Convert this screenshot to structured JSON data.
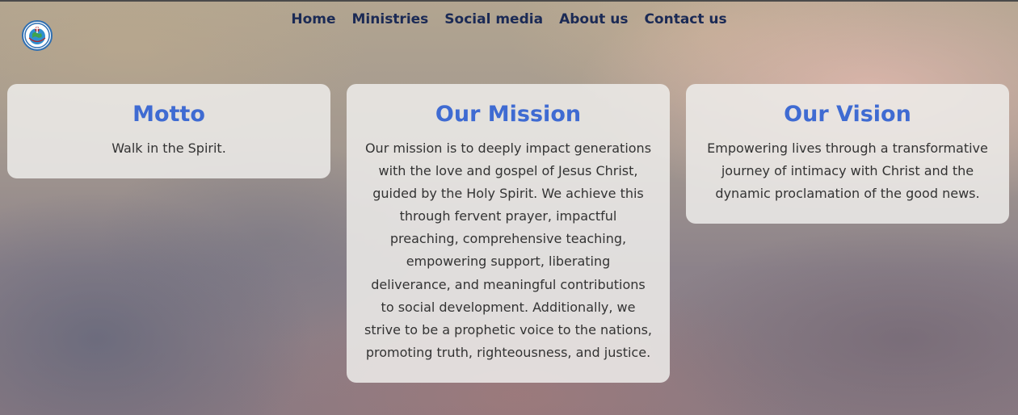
{
  "nav": {
    "items": [
      "Home",
      "Ministries",
      "Social media",
      "About us",
      "Contact us"
    ]
  },
  "logo": {
    "icon": "church-globe-logo-icon"
  },
  "cards": {
    "motto": {
      "title": "Motto",
      "text": "Walk in the Spirit."
    },
    "mission": {
      "title": "Our Mission",
      "text": "Our mission is to deeply impact generations with the love and gospel of Jesus Christ, guided by the Holy Spirit. We achieve this through fervent prayer, impactful preaching, comprehensive teaching, empowering support, liberating deliverance, and meaningful contributions to social development. Additionally, we strive to be a prophetic voice to the nations, promoting truth, righteousness, and justice."
    },
    "vision": {
      "title": "Our Vision",
      "text": "Empowering lives through a transformative journey of intimacy with Christ and the dynamic proclamation of the good news."
    }
  },
  "colors": {
    "nav_text": "#1b2a55",
    "card_title": "#3f6bd2",
    "card_text": "#333333",
    "card_bg": "#eeeceae0"
  }
}
